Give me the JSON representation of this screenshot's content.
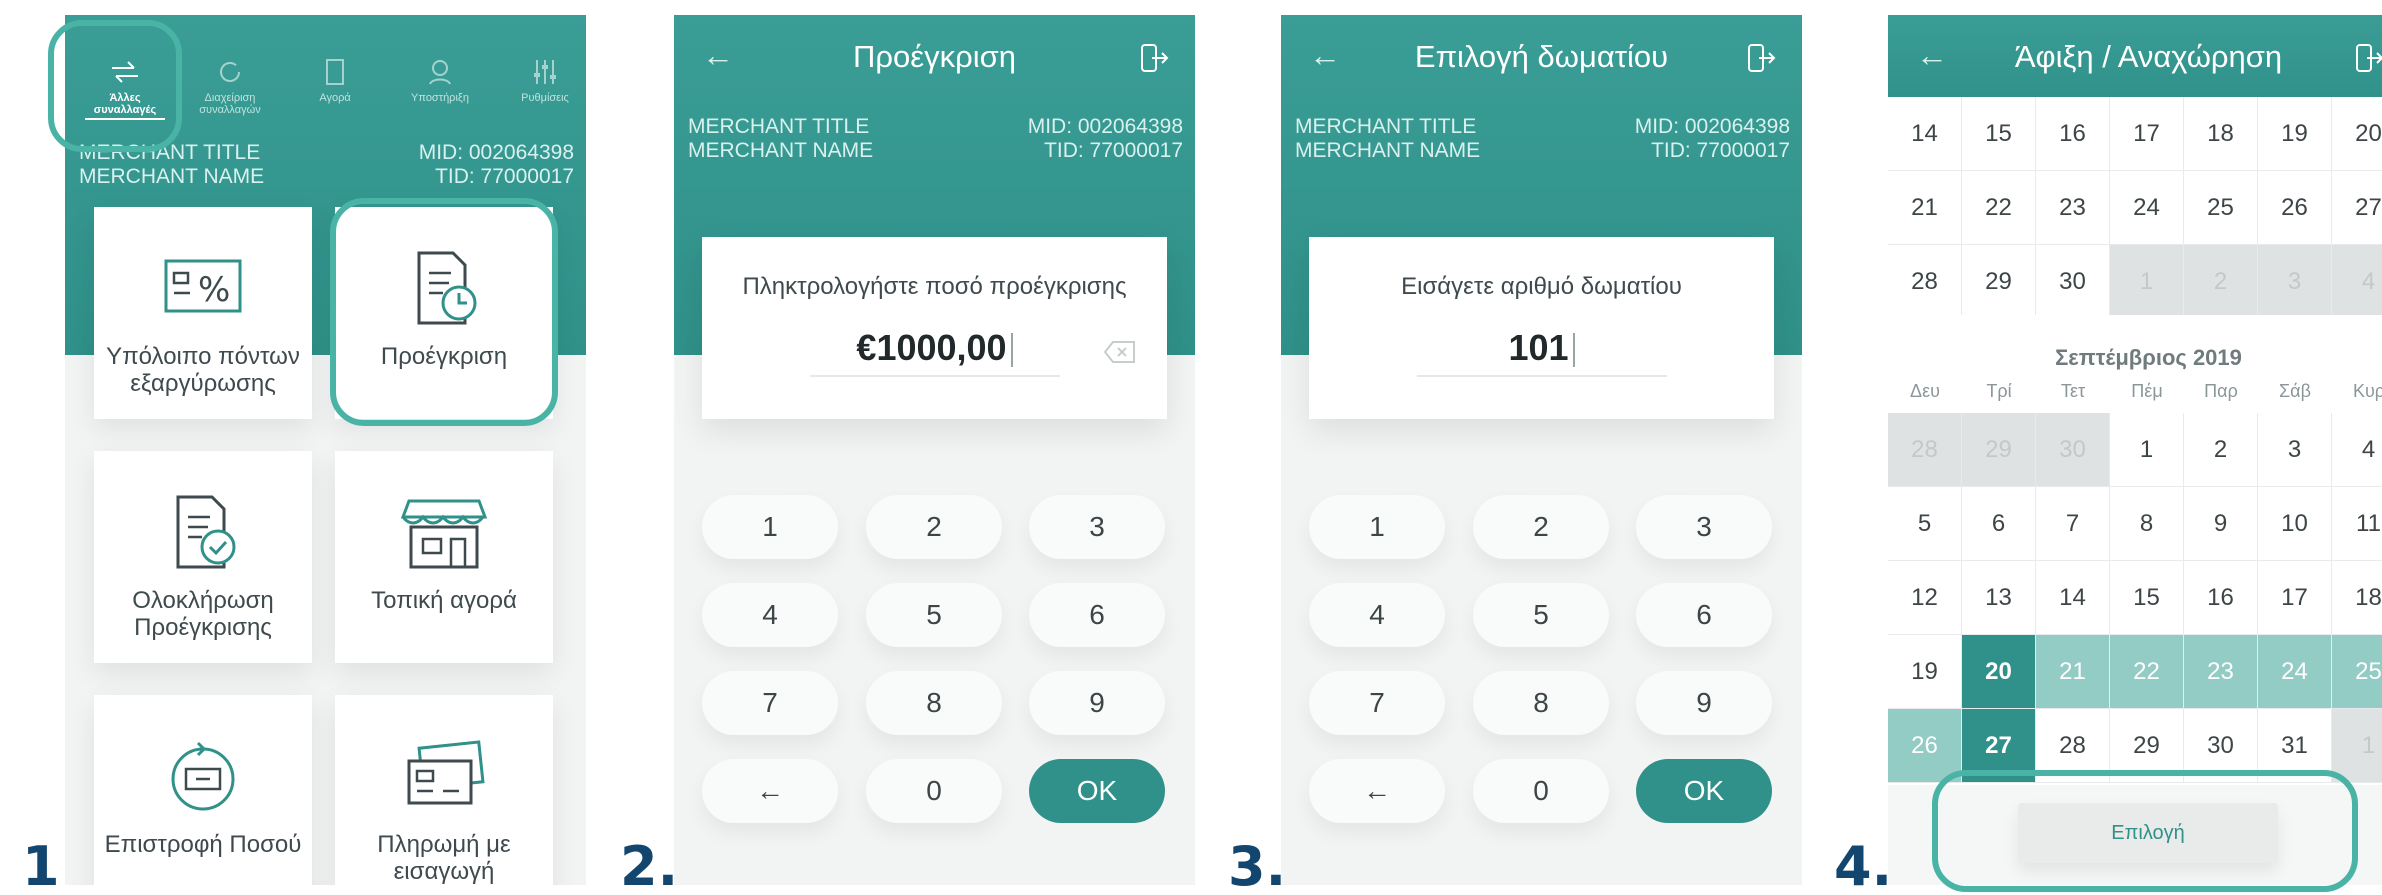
{
  "steps": [
    "1.",
    "2.",
    "3.",
    "4."
  ],
  "colors": {
    "teal": "#2f9189",
    "highlight": "#49b3a6",
    "step_number": "#13466e"
  },
  "screen1": {
    "top_tabs": [
      {
        "label": "Άλλες συναλλαγές",
        "icon": "arrows-icon",
        "active": true
      },
      {
        "label": "Διαχείριση συναλλαγών",
        "icon": "refresh-icon",
        "active": false
      },
      {
        "label": "Αγορά",
        "icon": "card-icon",
        "active": false
      },
      {
        "label": "Υποστήριξη",
        "icon": "support-icon",
        "active": false
      },
      {
        "label": "Ρυθμίσεις",
        "icon": "sliders-icon",
        "active": false
      }
    ],
    "merchant_title": "MERCHANT TITLE",
    "merchant_name": "MERCHANT NAME",
    "mid": "MID: 002064398",
    "tid": "TID: 77000017",
    "tiles": [
      {
        "label": "Υπόλοιπο πόντων εξαργύρωσης",
        "icon": "points-percent-icon"
      },
      {
        "label": "Προέγκριση",
        "icon": "document-clock-icon"
      },
      {
        "label": "Ολοκλήρωση Προέγκρισης",
        "icon": "document-check-icon"
      },
      {
        "label": "Τοπική αγορά",
        "icon": "store-icon"
      },
      {
        "label": "Επιστροφή Ποσού",
        "icon": "refund-icon"
      },
      {
        "label": "Πληρωμή με εισαγωγή",
        "icon": "cards-icon"
      }
    ]
  },
  "screen2": {
    "title": "Προέγκριση",
    "merchant_title": "MERCHANT TITLE",
    "merchant_name": "MERCHANT NAME",
    "mid": "MID: 002064398",
    "tid": "TID: 77000017",
    "prompt": "Πληκτρολογήστε ποσό προέγκρισης",
    "value": "€1000,00",
    "keys": [
      "1",
      "2",
      "3",
      "4",
      "5",
      "6",
      "7",
      "8",
      "9",
      "←",
      "0",
      "OK"
    ]
  },
  "screen3": {
    "title": "Επιλογή δωματίου",
    "merchant_title": "MERCHANT TITLE",
    "merchant_name": "MERCHANT NAME",
    "mid": "MID: 002064398",
    "tid": "TID: 77000017",
    "prompt": "Εισάγετε αριθμό δωματίου",
    "value": "101",
    "keys": [
      "1",
      "2",
      "3",
      "4",
      "5",
      "6",
      "7",
      "8",
      "9",
      "←",
      "0",
      "OK"
    ]
  },
  "screen4": {
    "title": "Άφιξη / Αναχώρηση",
    "prev_month_rows": [
      [
        {
          "d": "14"
        },
        {
          "d": "15"
        },
        {
          "d": "16"
        },
        {
          "d": "17"
        },
        {
          "d": "18"
        },
        {
          "d": "19"
        },
        {
          "d": "20"
        }
      ],
      [
        {
          "d": "21"
        },
        {
          "d": "22"
        },
        {
          "d": "23"
        },
        {
          "d": "24"
        },
        {
          "d": "25"
        },
        {
          "d": "26"
        },
        {
          "d": "27"
        }
      ],
      [
        {
          "d": "28"
        },
        {
          "d": "29"
        },
        {
          "d": "30"
        },
        {
          "d": "1",
          "s": "out"
        },
        {
          "d": "2",
          "s": "out"
        },
        {
          "d": "3",
          "s": "out"
        },
        {
          "d": "4",
          "s": "out"
        }
      ]
    ],
    "month_title": "Σεπτέμβριος 2019",
    "weekdays": [
      "Δευ",
      "Τρί",
      "Τετ",
      "Πέμ",
      "Παρ",
      "Σάβ",
      "Κυρ"
    ],
    "month_rows": [
      [
        {
          "d": "28",
          "s": "out"
        },
        {
          "d": "29",
          "s": "out"
        },
        {
          "d": "30",
          "s": "out"
        },
        {
          "d": "1"
        },
        {
          "d": "2"
        },
        {
          "d": "3"
        },
        {
          "d": "4"
        }
      ],
      [
        {
          "d": "5"
        },
        {
          "d": "6"
        },
        {
          "d": "7"
        },
        {
          "d": "8"
        },
        {
          "d": "9"
        },
        {
          "d": "10"
        },
        {
          "d": "11"
        }
      ],
      [
        {
          "d": "12"
        },
        {
          "d": "13"
        },
        {
          "d": "14"
        },
        {
          "d": "15"
        },
        {
          "d": "16"
        },
        {
          "d": "17"
        },
        {
          "d": "18"
        }
      ],
      [
        {
          "d": "19"
        },
        {
          "d": "20",
          "s": "sel"
        },
        {
          "d": "21",
          "s": "range"
        },
        {
          "d": "22",
          "s": "range"
        },
        {
          "d": "23",
          "s": "range"
        },
        {
          "d": "24",
          "s": "range"
        },
        {
          "d": "25",
          "s": "range"
        }
      ],
      [
        {
          "d": "26",
          "s": "range"
        },
        {
          "d": "27",
          "s": "sel"
        },
        {
          "d": "28"
        },
        {
          "d": "29"
        },
        {
          "d": "30"
        },
        {
          "d": "31"
        },
        {
          "d": "1",
          "s": "out"
        }
      ]
    ],
    "select_label": "Επιλογή"
  }
}
